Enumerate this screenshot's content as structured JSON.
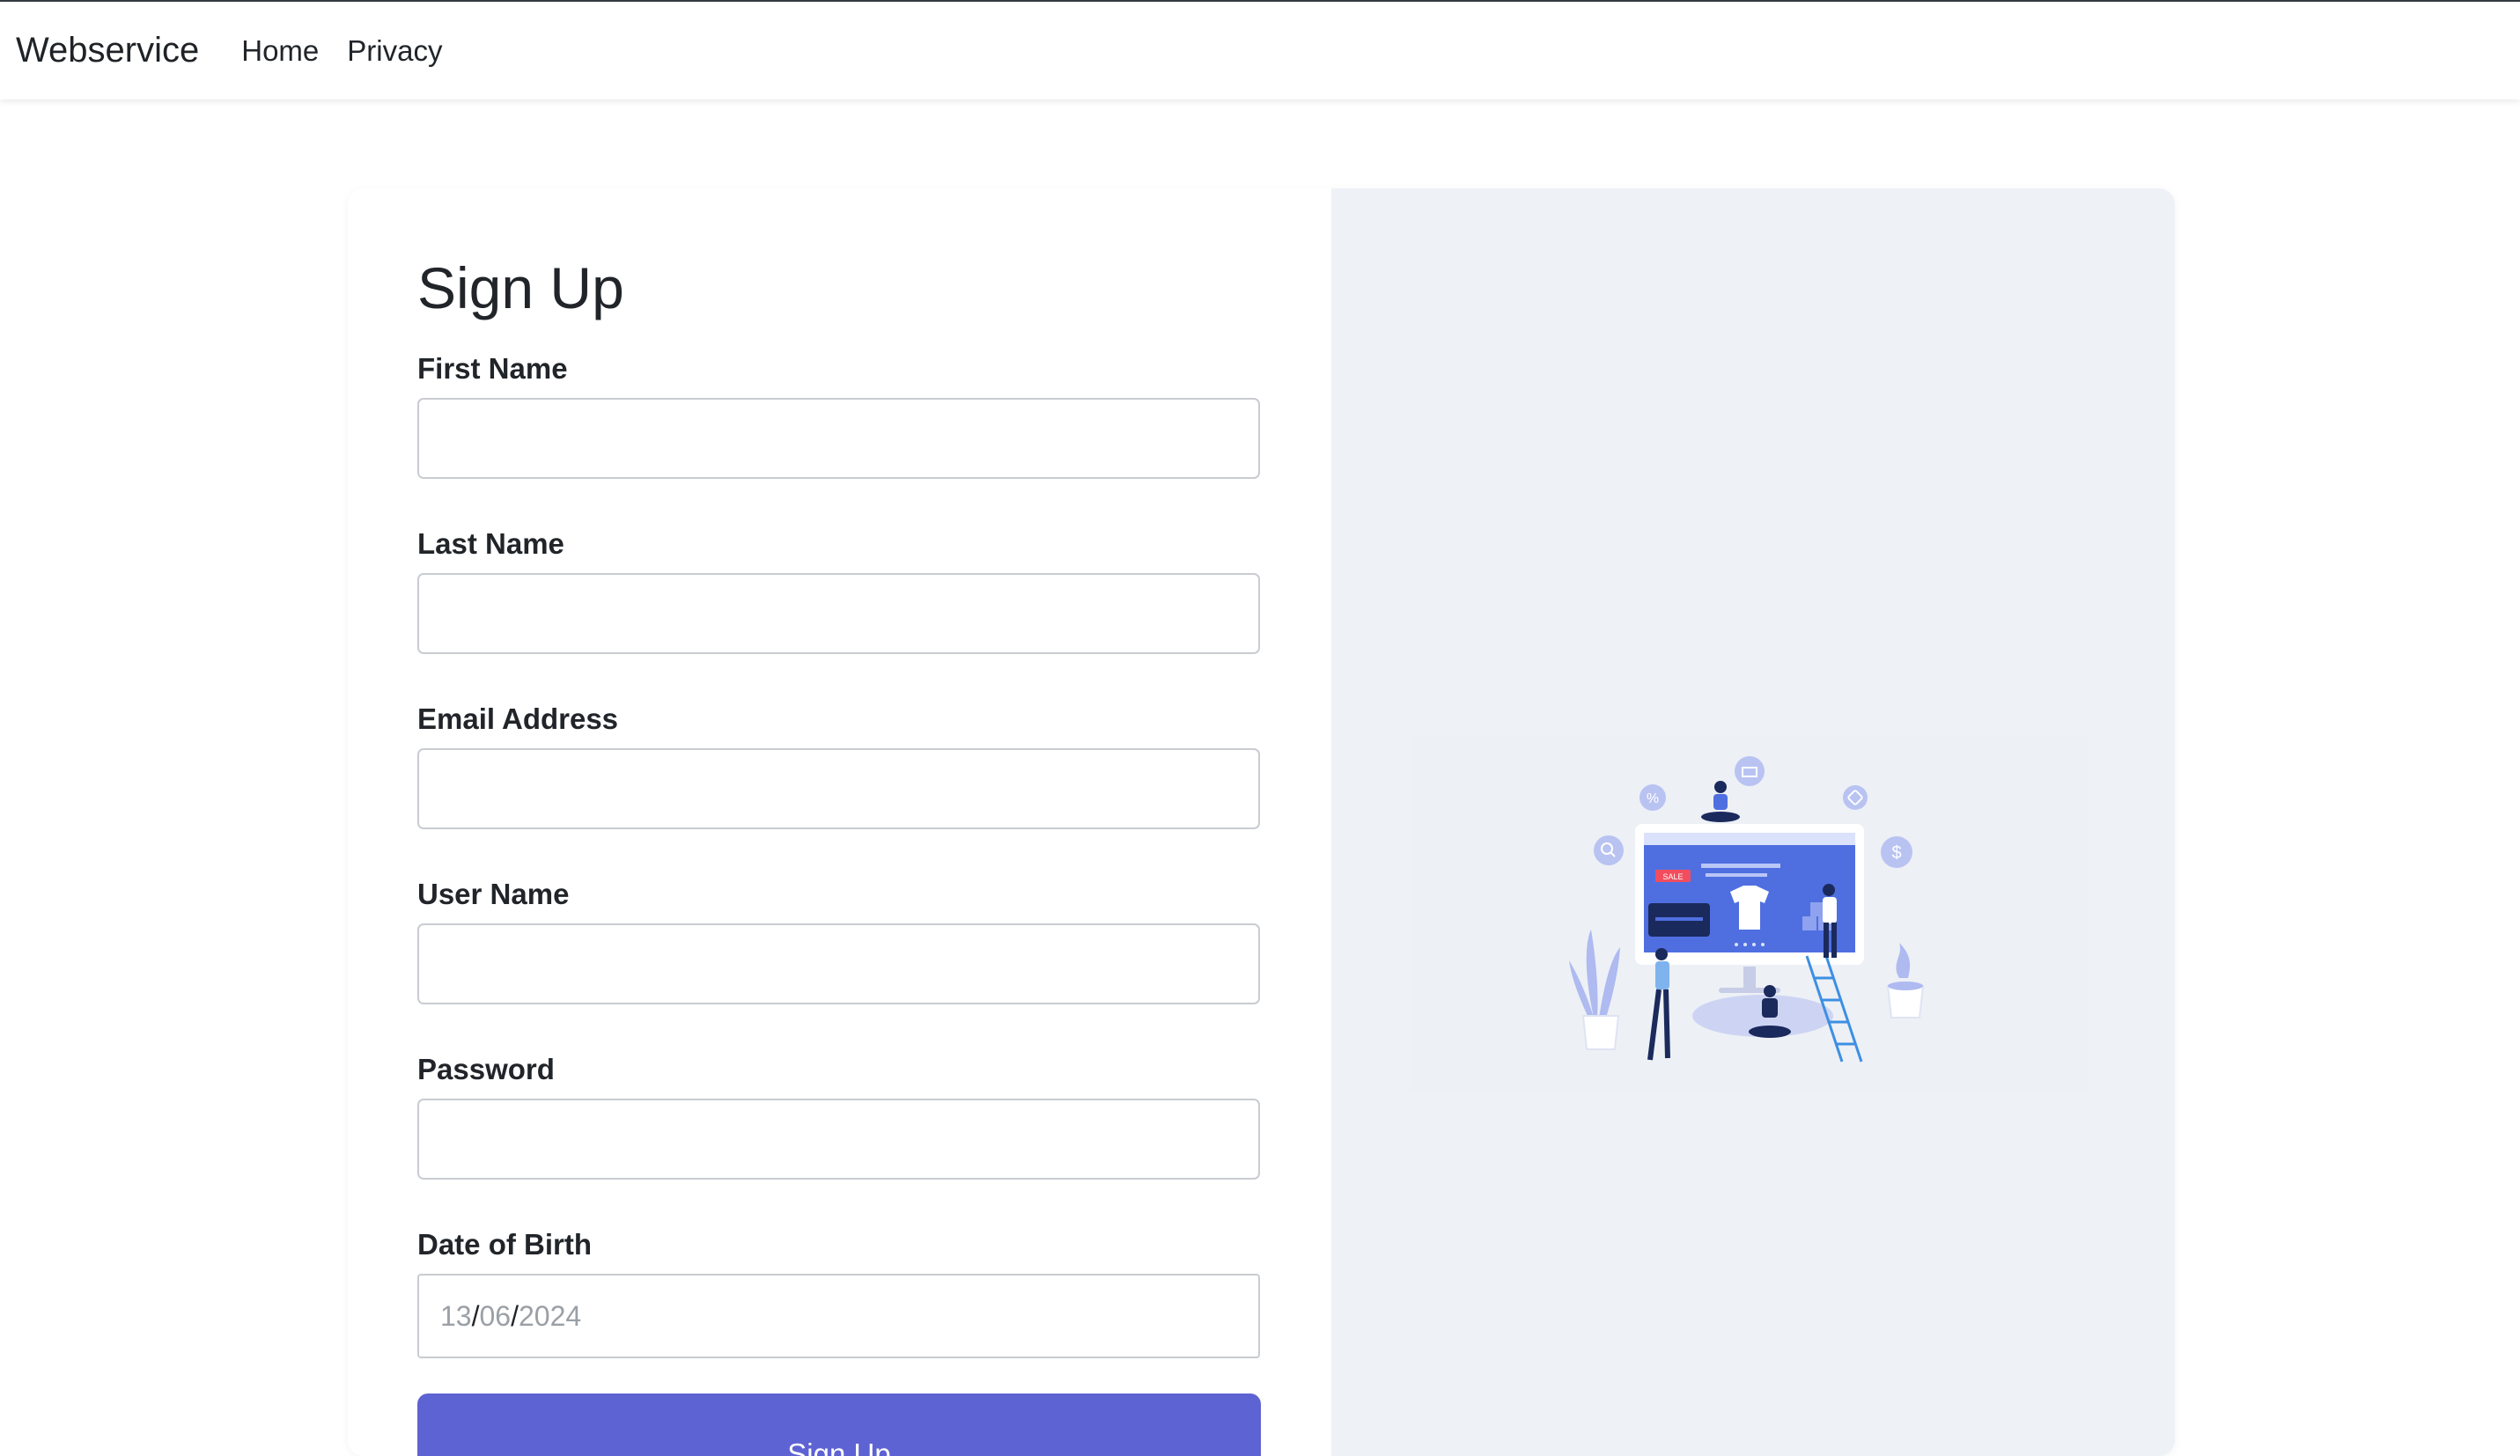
{
  "navbar": {
    "brand": "Webservice",
    "links": [
      "Home",
      "Privacy"
    ]
  },
  "form": {
    "title": "Sign Up",
    "fields": [
      {
        "label": "First Name",
        "value": ""
      },
      {
        "label": "Last Name",
        "value": ""
      },
      {
        "label": "Email Address",
        "value": ""
      },
      {
        "label": "User Name",
        "value": ""
      },
      {
        "label": "Password",
        "value": ""
      }
    ],
    "dob": {
      "label": "Date of Birth",
      "day": "13",
      "month": "06",
      "year": "2024",
      "separator": "/"
    },
    "submit_label": "Sign Up"
  },
  "illustration": {
    "sale_tag": "SALE",
    "icons": [
      "percent-icon",
      "basket-icon",
      "tag-icon",
      "search-icon",
      "dollar-icon"
    ]
  },
  "colors": {
    "accent": "#5d63d3",
    "art_bg": "#eef1f6",
    "illus_blue": "#4f6fe0"
  }
}
